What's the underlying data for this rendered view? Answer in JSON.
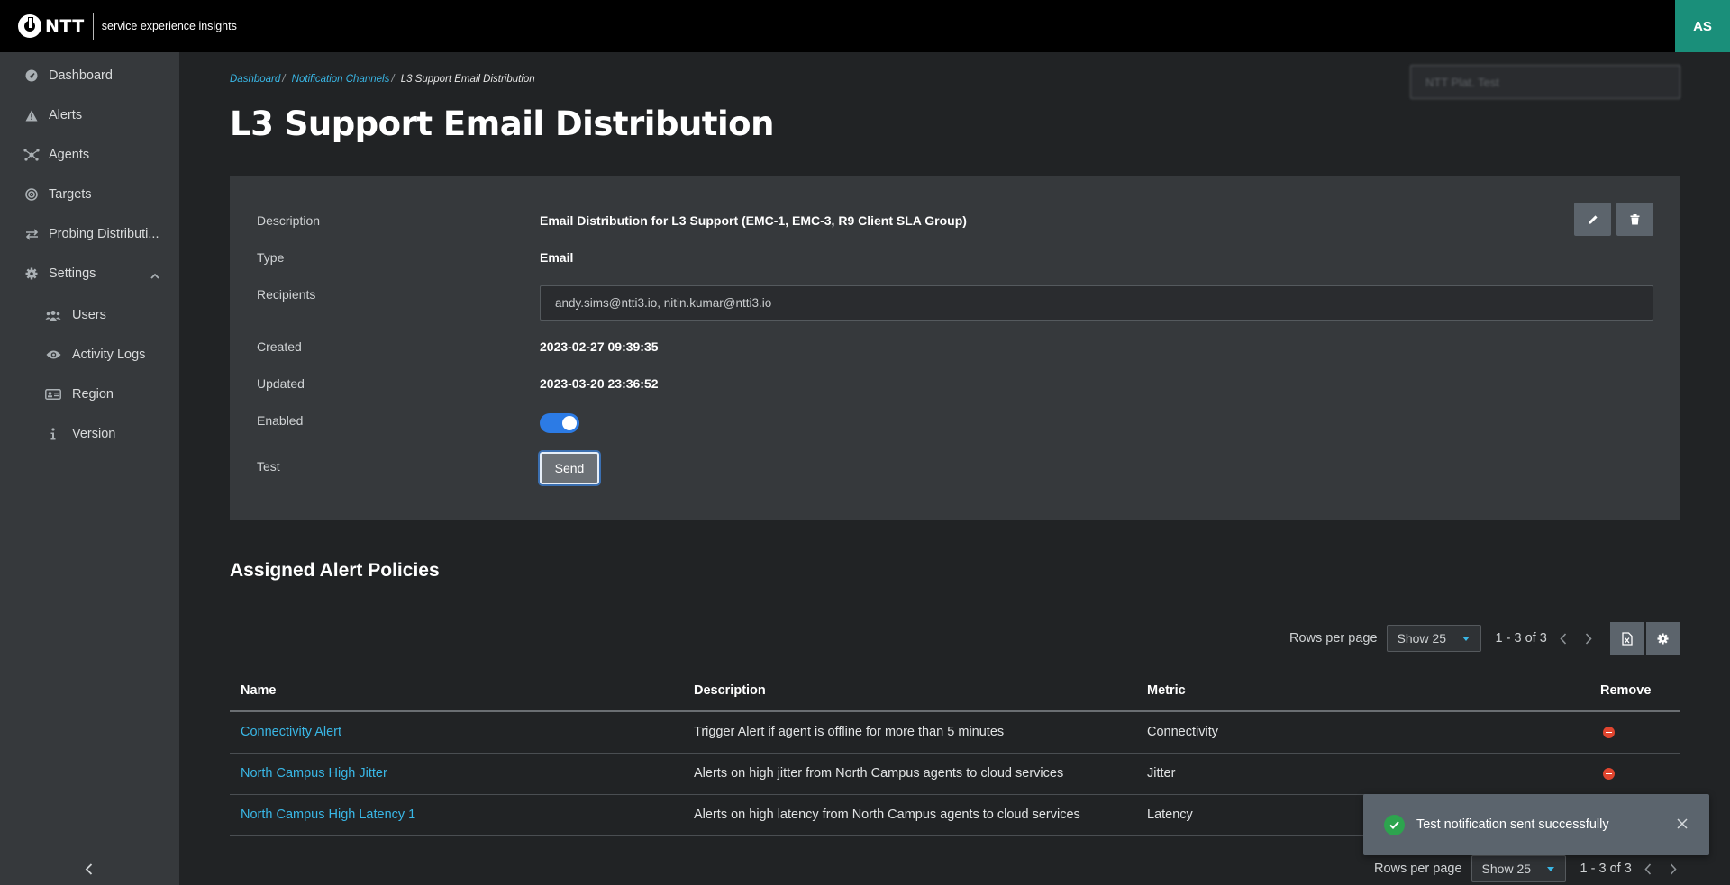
{
  "header": {
    "logo_text": "NTT",
    "product": "service experience insights",
    "avatar_initials": "AS",
    "avatar_color": "#1a8f7a"
  },
  "sidebar": {
    "items": [
      {
        "label": "Dashboard",
        "icon": "dashboard-icon"
      },
      {
        "label": "Alerts",
        "icon": "warning-icon"
      },
      {
        "label": "Agents",
        "icon": "agents-icon"
      },
      {
        "label": "Targets",
        "icon": "target-icon"
      },
      {
        "label": "Probing Distributi...",
        "icon": "exchange-icon"
      },
      {
        "label": "Settings",
        "icon": "gear-icon"
      }
    ],
    "settings_children": [
      {
        "label": "Users",
        "icon": "users-icon"
      },
      {
        "label": "Activity Logs",
        "icon": "eye-icon"
      },
      {
        "label": "Region",
        "icon": "id-card-icon"
      },
      {
        "label": "Version",
        "icon": "info-icon"
      }
    ]
  },
  "breadcrumb": {
    "items": [
      "Dashboard",
      "Notification Channels"
    ],
    "current": "L3 Support Email Distribution"
  },
  "search": {
    "placeholder": "NTT Plat. Test"
  },
  "page": {
    "title": "L3 Support Email Distribution"
  },
  "details": {
    "labels": {
      "description": "Description",
      "type": "Type",
      "recipients": "Recipients",
      "created": "Created",
      "updated": "Updated",
      "enabled": "Enabled",
      "test": "Test"
    },
    "description": "Email Distribution for L3 Support (EMC-1, EMC-3, R9 Client SLA Group)",
    "type": "Email",
    "recipients": "andy.sims@ntti3.io, nitin.kumar@ntti3.io",
    "created": "2023-02-27 09:39:35",
    "updated": "2023-03-20 23:36:52",
    "enabled": true,
    "send_label": "Send"
  },
  "policies": {
    "section_title": "Assigned Alert Policies",
    "rows_per_page_label": "Rows per page",
    "rows_per_page_value": "Show 25",
    "range_text": "1 - 3 of 3",
    "columns": [
      "Name",
      "Description",
      "Metric",
      "Remove"
    ],
    "rows": [
      {
        "name": "Connectivity Alert",
        "description": "Trigger Alert if agent is offline for more than 5 minutes",
        "metric": "Connectivity"
      },
      {
        "name": "North Campus High Jitter",
        "description": "Alerts on high jitter from North Campus agents to cloud services",
        "metric": "Jitter"
      },
      {
        "name": "North Campus High Latency 1",
        "description": "Alerts on high latency from North Campus agents to cloud services",
        "metric": "Latency"
      }
    ]
  },
  "toast": {
    "message": "Test notification sent successfully"
  },
  "colors": {
    "link": "#39b7e6",
    "toggle_on": "#2c7be5",
    "remove": "#e0452f",
    "success": "#2da44e"
  }
}
